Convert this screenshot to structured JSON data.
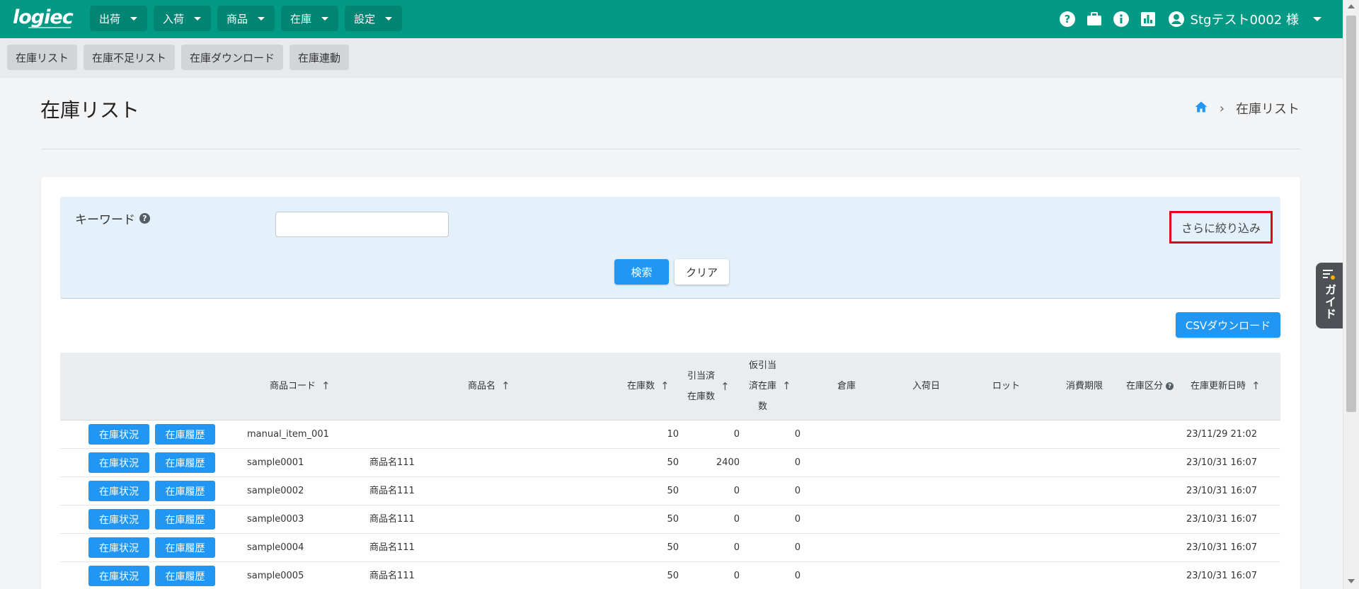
{
  "app": {
    "logo_text": "logiec",
    "nav": [
      {
        "label": "出荷"
      },
      {
        "label": "入荷"
      },
      {
        "label": "商品"
      },
      {
        "label": "在庫"
      },
      {
        "label": "設定"
      }
    ],
    "icons": [
      "help-icon",
      "briefcase-icon",
      "info-icon",
      "chart-icon",
      "account-icon"
    ],
    "user_name": "Stgテスト0002 様"
  },
  "subnav": {
    "tabs": [
      {
        "label": "在庫リスト"
      },
      {
        "label": "在庫不足リスト"
      },
      {
        "label": "在庫ダウンロード"
      },
      {
        "label": "在庫連動"
      }
    ]
  },
  "page": {
    "title": "在庫リスト",
    "breadcrumb": {
      "home_icon": "home-icon",
      "current": "在庫リスト"
    }
  },
  "search": {
    "keyword_label": "キーワード",
    "keyword_value": "",
    "keyword_placeholder": "",
    "more_filter_label": "さらに絞り込み",
    "search_label": "検索",
    "clear_label": "クリア",
    "csv_label": "CSVダウンロード"
  },
  "table": {
    "columns": {
      "code": "商品コード",
      "name": "商品名",
      "stock": "在庫数",
      "allocated_1": "引当済",
      "allocated_2": "在庫数",
      "provisional_1": "仮引当",
      "provisional_2": "済在庫",
      "provisional_3": "数",
      "warehouse": "倉庫",
      "arrival": "入荷日",
      "lot": "ロット",
      "expiry": "消費期限",
      "category": "在庫区分",
      "updated": "在庫更新日時"
    },
    "row_buttons": {
      "status": "在庫状況",
      "history": "在庫履歴"
    },
    "rows": [
      {
        "code": "manual_item_001",
        "name": "",
        "stock": "10",
        "allocated": "0",
        "provisional": "0",
        "updated": "23/11/29 21:02"
      },
      {
        "code": "sample0001",
        "name": "商品名111",
        "stock": "50",
        "allocated": "2400",
        "provisional": "0",
        "updated": "23/10/31 16:07"
      },
      {
        "code": "sample0002",
        "name": "商品名111",
        "stock": "50",
        "allocated": "0",
        "provisional": "0",
        "updated": "23/10/31 16:07"
      },
      {
        "code": "sample0003",
        "name": "商品名111",
        "stock": "50",
        "allocated": "0",
        "provisional": "0",
        "updated": "23/10/31 16:07"
      },
      {
        "code": "sample0004",
        "name": "商品名111",
        "stock": "50",
        "allocated": "0",
        "provisional": "0",
        "updated": "23/10/31 16:07"
      },
      {
        "code": "sample0005",
        "name": "商品名111",
        "stock": "50",
        "allocated": "0",
        "provisional": "0",
        "updated": "23/10/31 16:07"
      }
    ]
  },
  "guide": {
    "label": "ガイド"
  },
  "colors": {
    "header": "#039a85",
    "primary": "#2196f3",
    "highlight": "#e3001b"
  }
}
